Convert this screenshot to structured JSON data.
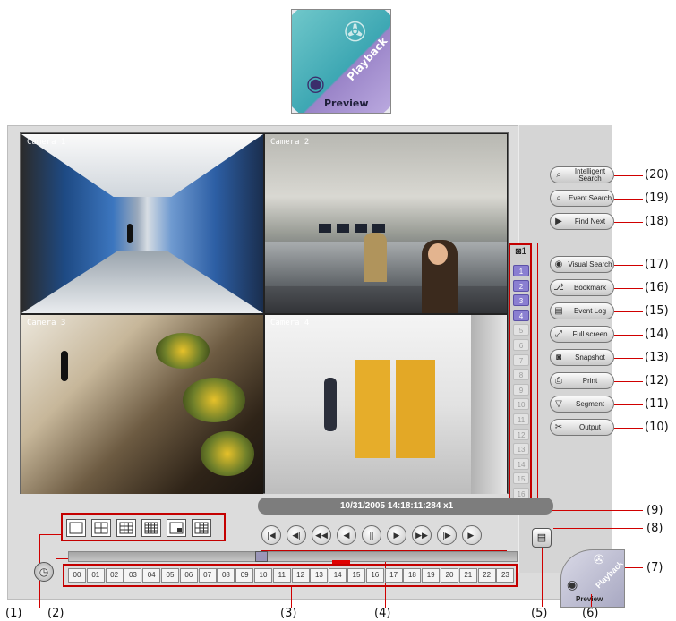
{
  "logo": {
    "playback_label": "Playback",
    "preview_label": "Preview"
  },
  "cameras": [
    {
      "label": "Camera 1"
    },
    {
      "label": "Camera 2"
    },
    {
      "label": "Camera 3"
    },
    {
      "label": "Camera 4"
    }
  ],
  "channels": {
    "header": "1",
    "items": [
      "1",
      "2",
      "3",
      "4",
      "5",
      "6",
      "7",
      "8",
      "9",
      "10",
      "11",
      "12",
      "13",
      "14",
      "15",
      "16"
    ],
    "active": [
      true,
      true,
      true,
      true,
      false,
      false,
      false,
      false,
      false,
      false,
      false,
      false,
      false,
      false,
      false,
      false
    ]
  },
  "right_buttons": [
    {
      "label": "Intelligent Search",
      "icon": "intelligent-search-icon",
      "callout": "(20)"
    },
    {
      "label": "Event Search",
      "icon": "event-search-icon",
      "callout": "(19)"
    },
    {
      "label": "Find Next",
      "icon": "find-next-icon",
      "callout": "(18)"
    },
    {
      "label": "Visual Search",
      "icon": "visual-search-icon",
      "callout": "(17)"
    },
    {
      "label": "Bookmark",
      "icon": "bookmark-icon",
      "callout": "(16)"
    },
    {
      "label": "Event Log",
      "icon": "event-log-icon",
      "callout": "(15)"
    },
    {
      "label": "Full screen",
      "icon": "full-screen-icon",
      "callout": "(14)"
    },
    {
      "label": "Snapshot",
      "icon": "camera-icon",
      "callout": "(13)"
    },
    {
      "label": "Print",
      "icon": "printer-icon",
      "callout": "(12)"
    },
    {
      "label": "Segment",
      "icon": "segment-icon",
      "callout": "(11)"
    },
    {
      "label": "Output",
      "icon": "scissors-icon",
      "callout": "(10)"
    }
  ],
  "status": {
    "text": "10/31/2005 14:18:11:284    x1"
  },
  "hours": [
    "00",
    "01",
    "02",
    "03",
    "04",
    "05",
    "06",
    "07",
    "08",
    "09",
    "10",
    "11",
    "12",
    "13",
    "14",
    "15",
    "16",
    "17",
    "18",
    "19",
    "20",
    "21",
    "22",
    "23"
  ],
  "selected_hour": "14",
  "callouts": {
    "c1": "(1)",
    "c2": "(2)",
    "c3": "(3)",
    "c4": "(4)",
    "c5": "(5)",
    "c6": "(6)",
    "c7": "(7)",
    "c8": "(8)",
    "c9": "(9)"
  },
  "colors": {
    "callout_line": "#d00000",
    "active_channel": "#8a7fd1"
  }
}
